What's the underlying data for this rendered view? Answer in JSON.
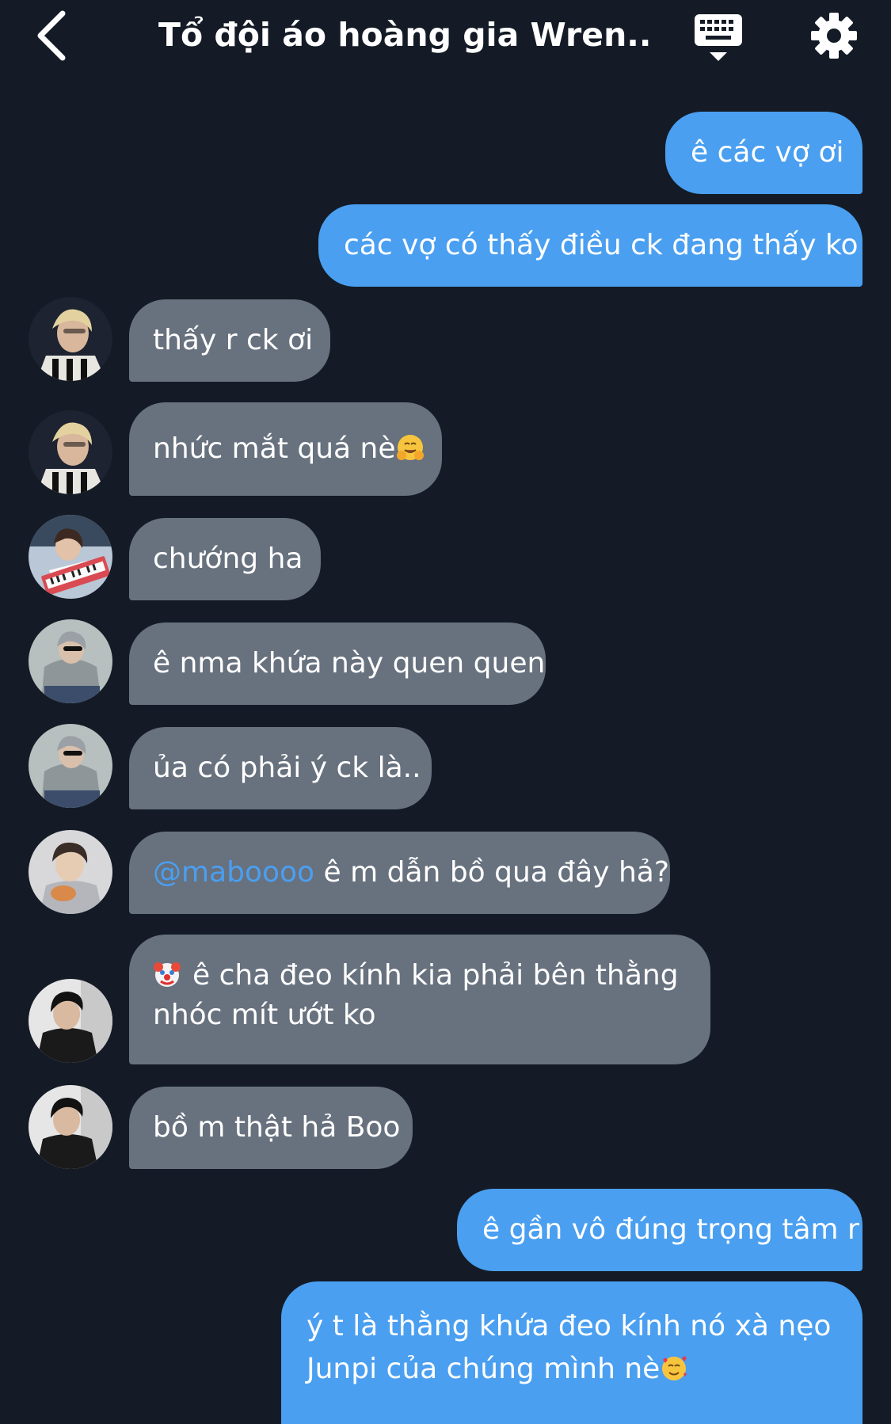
{
  "header": {
    "title": "Tổ đội áo hoàng gia Wren...",
    "icons": {
      "back": "chevron-left-icon",
      "keyboard": "keyboard-hide-icon",
      "settings": "gear-icon"
    }
  },
  "colors": {
    "background": "#141b26",
    "outgoing_bubble": "#4a9ff0",
    "incoming_bubble": "#68717e",
    "mention": "#4a9ff0",
    "text": "#ffffff"
  },
  "messages": [
    {
      "direction": "outgoing",
      "text": "ê các vợ ơi"
    },
    {
      "direction": "outgoing",
      "text": "các vợ có thấy điều ck đang thấy ko"
    },
    {
      "direction": "incoming",
      "avatar": "avatar-1",
      "text": "thấy r ck ơi"
    },
    {
      "direction": "incoming",
      "avatar": "avatar-1",
      "text": "nhức mắt quá nè",
      "emoji": "hugging-face-emoji"
    },
    {
      "direction": "incoming",
      "avatar": "avatar-2",
      "text": "chướng ha"
    },
    {
      "direction": "incoming",
      "avatar": "avatar-3",
      "text": "ê nma khứa này quen quen"
    },
    {
      "direction": "incoming",
      "avatar": "avatar-3",
      "text": "ủa có phải ý ck là.."
    },
    {
      "direction": "incoming",
      "avatar": "avatar-4",
      "mention": "@maboooo",
      "text": " ê m dẫn bồ qua đây hả?"
    },
    {
      "direction": "incoming",
      "avatar": "avatar-5",
      "emoji": "clown-face-emoji",
      "text_line1": "ê cha đeo kính kia phải bên thằng",
      "text_line2": "nhóc mít ướt ko"
    },
    {
      "direction": "incoming",
      "avatar": "avatar-5",
      "text": "bồ m thật hả Boo"
    },
    {
      "direction": "outgoing",
      "text": "ê gần vô đúng trọng tâm r"
    },
    {
      "direction": "outgoing",
      "text_line1": "ý t là thằng khứa đeo kính nó xà nẹo",
      "text_line2": "Junpi của chúng mình nè",
      "emoji": "smiling-face-with-hearts-emoji"
    }
  ]
}
